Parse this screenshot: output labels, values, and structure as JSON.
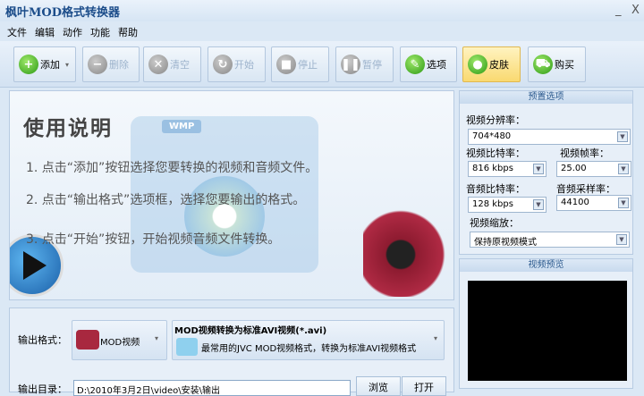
{
  "window": {
    "title": "枫叶MOD格式转换器",
    "minimize": "_",
    "close": "X"
  },
  "menu": [
    "文件",
    "编辑",
    "动作",
    "功能",
    "帮助"
  ],
  "toolbar": [
    {
      "label": "添加",
      "icon": "plus-icon",
      "glyph": "+",
      "state": "enabled",
      "dropdown": "▾"
    },
    {
      "label": "删除",
      "icon": "minus-icon",
      "glyph": "−",
      "state": "disabled"
    },
    {
      "label": "清空",
      "icon": "clear-icon",
      "glyph": "✕",
      "state": "disabled"
    },
    {
      "label": "开始",
      "icon": "refresh-icon",
      "glyph": "↻",
      "state": "disabled"
    },
    {
      "label": "停止",
      "icon": "stop-icon",
      "glyph": "■",
      "state": "disabled"
    },
    {
      "label": "暂停",
      "icon": "pause-icon",
      "glyph": "❚❚",
      "state": "disabled"
    },
    {
      "label": "选项",
      "icon": "tools-icon",
      "glyph": "✎",
      "state": "enabled"
    },
    {
      "label": "皮肤",
      "icon": "apple-icon",
      "glyph": "●",
      "state": "selected"
    },
    {
      "label": "购买",
      "icon": "cart-icon",
      "glyph": "⛟",
      "state": "enabled"
    }
  ],
  "guide": {
    "title": "使用说明",
    "steps": [
      "1. 点击“添加”按钮选择您要转换的视频和音频文件。",
      "2. 点击“输出格式”选项框，选择您要输出的格式。",
      "3. 点击“开始”按钮，开始视频音频文件转换。"
    ],
    "wmp": "WMP"
  },
  "output": {
    "format_label": "输出格式：",
    "format_value": "MOD视频",
    "profile_title": "MOD视频转换为标准AVI视频(*.avi)",
    "profile_desc": "最常用的JVC MOD视频格式，转换为标准AVI视频格式",
    "dir_label": "输出目录：",
    "dir_value": "D:\\2010年3月2日\\video\\安装\\输出",
    "browse": "浏览",
    "open": "打开"
  },
  "preset": {
    "header": "预置选项",
    "resolution_label": "视频分辨率：",
    "resolution": "704*480",
    "vbitrate_label": "视频比特率：",
    "vbitrate": "816 kbps",
    "framerate_label": "视频帧率：",
    "framerate": "25.00",
    "abitrate_label": "音频比特率：",
    "abitrate": "128 kbps",
    "samplerate_label": "音频采样率：",
    "samplerate": "44100",
    "zoom_label": "视频缩放：",
    "zoom": "保持原视频模式"
  },
  "preview": {
    "header": "视频预览"
  }
}
